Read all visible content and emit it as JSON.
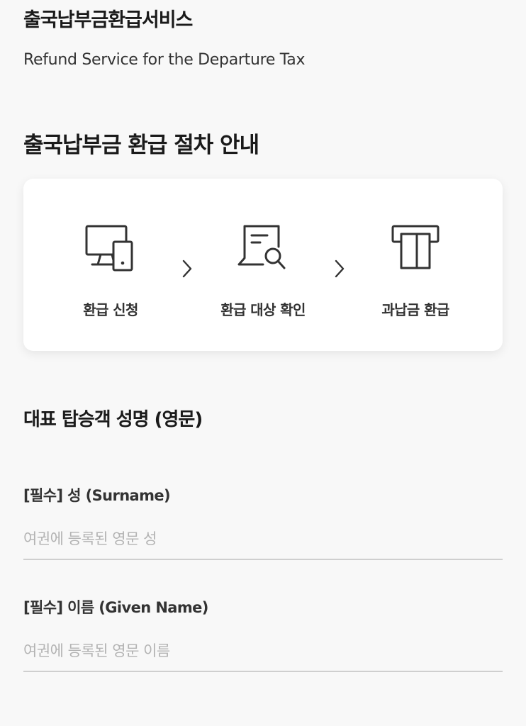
{
  "header": {
    "title": "출국납부금환급서비스",
    "subtitle": "Refund Service for the Departure Tax"
  },
  "procedure": {
    "title": "출국납부금 환급 절차 안내",
    "steps": [
      {
        "label": "환급 신청",
        "icon": "devices-icon"
      },
      {
        "label": "환급 대상 확인",
        "icon": "document-search-icon"
      },
      {
        "label": "과납금 환급",
        "icon": "card-reader-icon"
      }
    ],
    "arrow_icon": "chevron-right-icon"
  },
  "form": {
    "title": "대표 탑승객 성명 (영문)",
    "surname": {
      "label": "[필수] 성 (Surname)",
      "placeholder": "여권에 등록된 영문 성",
      "value": ""
    },
    "given_name": {
      "label": "[필수] 이름 (Given Name)",
      "placeholder": "여권에 등록된 영문 이름",
      "value": ""
    }
  },
  "colors": {
    "background": "#f8f8f8",
    "card": "#ffffff",
    "text": "#1a1a1a",
    "placeholder": "#b3b3b3",
    "underline": "#cfcfcf"
  }
}
